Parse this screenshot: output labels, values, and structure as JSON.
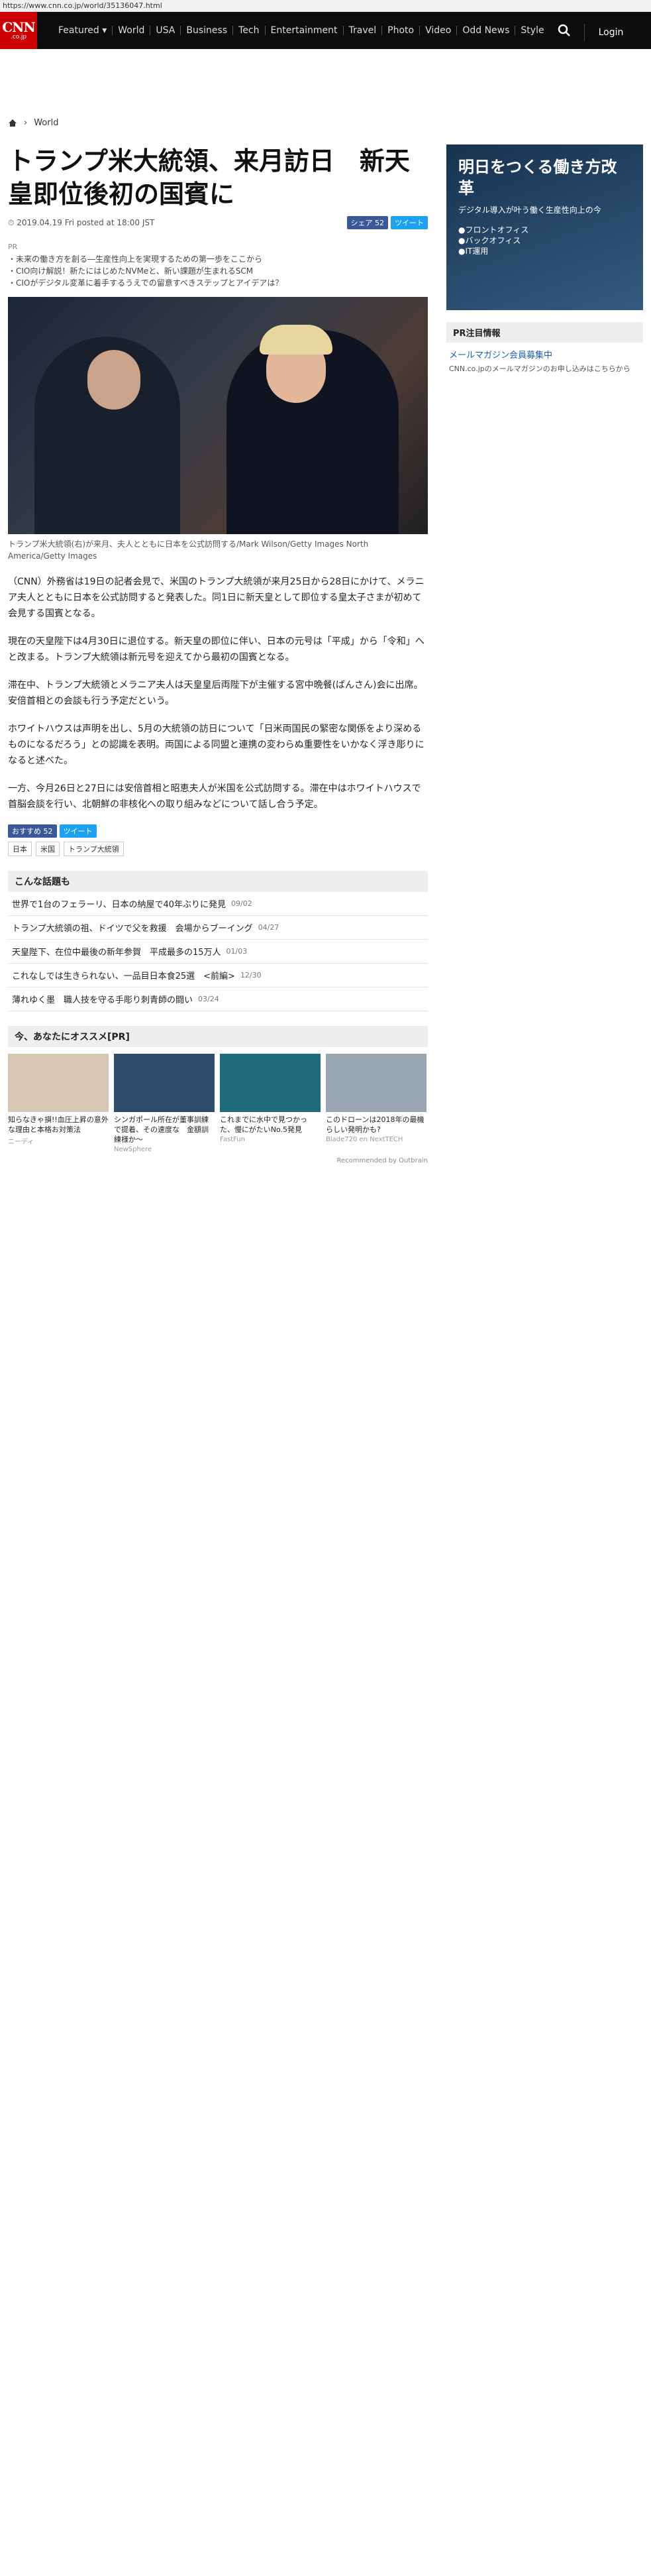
{
  "url": "https://www.cnn.co.jp/world/35136047.html",
  "nav": {
    "logo_big": "CNN",
    "logo_small": ".co.jp",
    "items": [
      "Featured ▾",
      "World",
      "USA",
      "Business",
      "Tech",
      "Entertainment",
      "Travel",
      "Photo",
      "Video",
      "Odd News",
      "Style"
    ],
    "login": "Login"
  },
  "breadcrumb": {
    "section": "World"
  },
  "article": {
    "title": "トランプ米大統領、来月訪日　新天皇即位後初の国賓に",
    "date": "2019.04.19 Fri posted at 18:00 JST",
    "share_fb": "シェア 52",
    "share_tw": "ツイート",
    "pr_label": "PR",
    "pr_links": [
      "・未来の働き方を創る―生産性向上を実現するための第一歩をここから",
      "・CIO向け解説！新たにはじめたNVMeと、新い課題が生まれるSCM",
      "・CIOがデジタル変革に着手するうえでの留意すべきステップとアイデアは？"
    ],
    "caption": "トランプ米大統領(右)が来月、夫人とともに日本を公式訪問する/Mark Wilson/Getty Images North America/Getty Images",
    "paragraphs": [
      "（CNN）外務省は19日の記者会見で、米国のトランプ大統領が来月25日から28日にかけて、メラニア夫人とともに日本を公式訪問すると発表した。同1日に新天皇として即位する皇太子さまが初めて会見する国賓となる。",
      "現在の天皇陛下は4月30日に退位する。新天皇の即位に伴い、日本の元号は「平成」から「令和」へと改まる。トランプ大統領は新元号を迎えてから最初の国賓となる。",
      "滞在中、トランプ大統領とメラニア夫人は天皇皇后両陛下が主催する宮中晩餐(ばんさん)会に出席。安倍首相との会談も行う予定だという。",
      "ホワイトハウスは声明を出し、5月の大統領の訪日について「日米両国民の緊密な関係をより深めるものになるだろう」との認識を表明。両国による同盟と連携の変わらぬ重要性をいかなく浮き彫りになると述べた。",
      "一方、今月26日と27日には安倍首相と昭恵夫人が米国を公式訪問する。滞在中はホワイトハウスで首脳会談を行い、北朝鮮の非核化への取り組みなどについて話し合う予定。"
    ],
    "share_fb2": "おすすめ 52",
    "tags": [
      "日本",
      "米国",
      "トランプ大統領"
    ]
  },
  "popular": {
    "title": "こんな話題も",
    "items": [
      {
        "text": "世界で1台のフェラーリ、日本の納屋で40年ぶりに発見",
        "date": "09/02"
      },
      {
        "text": "トランプ大統領の祖、ドイツで父を救援　会場からブーイング",
        "date": "04/27"
      },
      {
        "text": "天皇陛下、在位中最後の新年参賀　平成最多の15万人",
        "date": "01/03"
      },
      {
        "text": "これなしでは生きられない、一品目日本食25選　<前編>",
        "date": "12/30"
      },
      {
        "text": "薄れゆく墨　職人技を守る手彫り刺青師の闘い",
        "date": "03/24"
      }
    ]
  },
  "recommend1": {
    "title": "今、あなたにオススメ[PR]",
    "cards": [
      {
        "t": "知らなきゃ損!!血圧上昇の意外な理由と本格お対策法",
        "s": "ニーディ"
      },
      {
        "t": "シンガポール所在が董事訓練で提着、その速度な　金額訓練様か～",
        "s": "NewSphere"
      },
      {
        "t": "これまでに水中で見つかった、慢にがたいNo.5発見",
        "s": "FastFun"
      },
      {
        "t": "このドローンは2018年の最機らしい発明かも?",
        "s": "Blade720 en NextTECH"
      }
    ],
    "rec": "Recommended by Outbrain"
  },
  "sidebar": {
    "ad_title": "明日をつくる働き方改革",
    "ad_sub": "デジタル導入が叶う働く生産性向上の今",
    "ad_items": [
      "●フロントオフィス",
      "●バックオフィス",
      "●IT運用"
    ],
    "section1": "PR注目情報",
    "pr_text": "メールマガジン会員募集中",
    "pr_small": "CNN.co.jpのメールマガジンのお申し込みはこちらから"
  }
}
